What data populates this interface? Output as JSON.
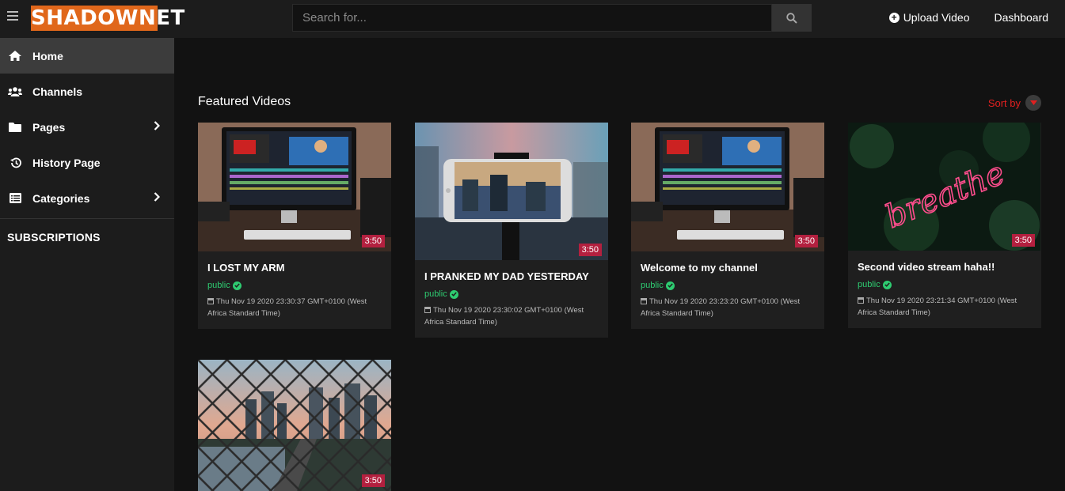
{
  "app": {
    "logo_text": "SHADOWNET",
    "brand_color": "#e0671b"
  },
  "search": {
    "placeholder": "Search for..."
  },
  "header": {
    "upload_label": "Upload Video",
    "dashboard_label": "Dashboard"
  },
  "sidebar": {
    "items": [
      {
        "label": "Home",
        "icon": "home-icon",
        "active": true
      },
      {
        "label": "Channels",
        "icon": "users-icon"
      },
      {
        "label": "Pages",
        "icon": "folder-icon",
        "has_submenu": true
      },
      {
        "label": "History Page",
        "icon": "history-icon"
      },
      {
        "label": "Categories",
        "icon": "list-icon",
        "has_submenu": true
      }
    ],
    "subscriptions_title": "SUBSCRIPTIONS"
  },
  "main": {
    "section_title": "Featured Videos",
    "sort_label": "Sort by",
    "accent_color": "#e02020",
    "videos": [
      {
        "title": "I LOST MY ARM",
        "status": "public",
        "date": "Thu Nov 19 2020 23:30:37 GMT+0100 (West Africa Standard Time)",
        "duration": "3:50",
        "thumbnail": "desk-computer-editing"
      },
      {
        "title": "I PRANKED MY DAD YESTERDAY",
        "status": "public",
        "date": "Thu Nov 19 2020 23:30:02 GMT+0100 (West Africa Standard Time)",
        "duration": "3:50",
        "thumbnail": "phone-on-tripod-city"
      },
      {
        "title": "Welcome to my channel",
        "status": "public",
        "date": "Thu Nov 19 2020 23:23:20 GMT+0100 (West Africa Standard Time)",
        "duration": "3:50",
        "thumbnail": "desk-computer-editing"
      },
      {
        "title": "Second video stream haha!!",
        "status": "public",
        "date": "Thu Nov 19 2020 23:21:34 GMT+0100 (West Africa Standard Time)",
        "duration": "3:50",
        "thumbnail": "neon-breathe-sign",
        "neon_text": "breathe"
      },
      {
        "title": "",
        "status": "",
        "date": "",
        "duration": "3:50",
        "thumbnail": "city-through-fence"
      }
    ]
  }
}
